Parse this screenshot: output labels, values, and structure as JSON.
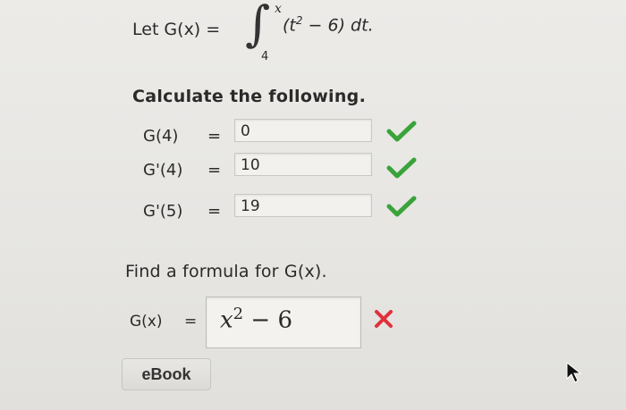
{
  "problem": {
    "let_text": "Let G(x) =",
    "integral_symbol": "∫",
    "upper_limit": "x",
    "lower_limit": "4",
    "integrand_pre": "(t",
    "integrand_sup": "2",
    "integrand_post": " − 6) dt."
  },
  "calculate": {
    "title": "Calculate the following.",
    "rows": [
      {
        "label": "G(4)",
        "eq": "=",
        "value": "0",
        "status": "correct"
      },
      {
        "label": "G'(4)",
        "eq": "=",
        "value": "10",
        "status": "correct"
      },
      {
        "label": "G'(5)",
        "eq": "=",
        "value": "19",
        "status": "correct"
      }
    ]
  },
  "formula": {
    "title": "Find a formula for G(x).",
    "label": "G(x)",
    "eq": "=",
    "answer_base": "x",
    "answer_sup": "2",
    "answer_rest": " − 6",
    "status": "incorrect"
  },
  "ebook_label": "eBook",
  "icons": {
    "correct": "check-icon",
    "incorrect": "x-icon",
    "pointer": "cursor-icon"
  },
  "colors": {
    "correct": "#3aa33a",
    "incorrect": "#e0303a"
  }
}
